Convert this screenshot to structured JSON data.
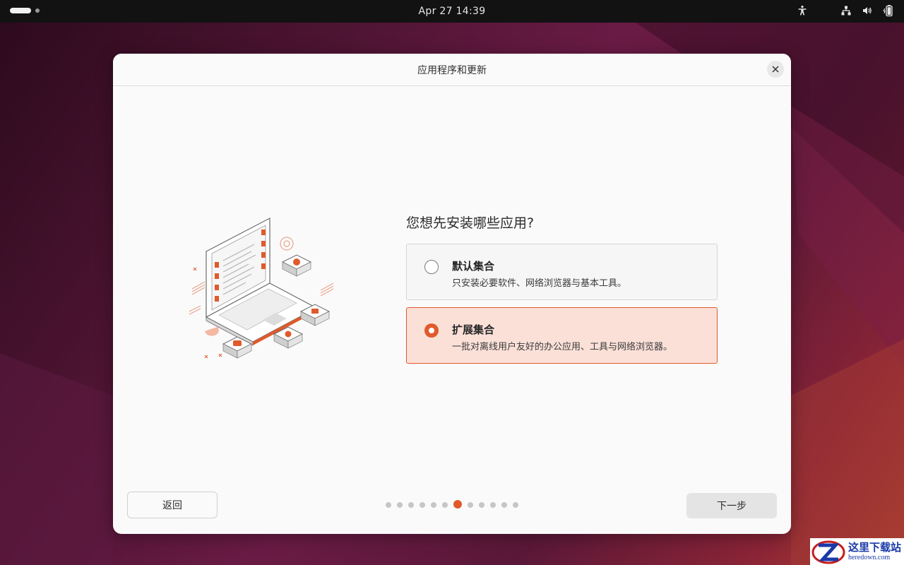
{
  "topbar": {
    "clock": "Apr 27  14:39"
  },
  "dialog": {
    "title": "应用程序和更新",
    "question": "您想先安装哪些应用?",
    "options": [
      {
        "title": "默认集合",
        "description": "只安装必要软件、网络浏览器与基本工具。",
        "selected": false
      },
      {
        "title": "扩展集合",
        "description": "一批对离线用户友好的办公应用、工具与网络浏览器。",
        "selected": true
      }
    ],
    "back_label": "返回",
    "next_label": "下一步",
    "progress": {
      "total": 12,
      "current": 7
    }
  },
  "watermark": {
    "cn": "这里下载站",
    "en": "heredown.com"
  },
  "colors": {
    "accent": "#e05a2b",
    "selected_bg": "#fbe0d8",
    "topbar_bg": "#121212"
  }
}
